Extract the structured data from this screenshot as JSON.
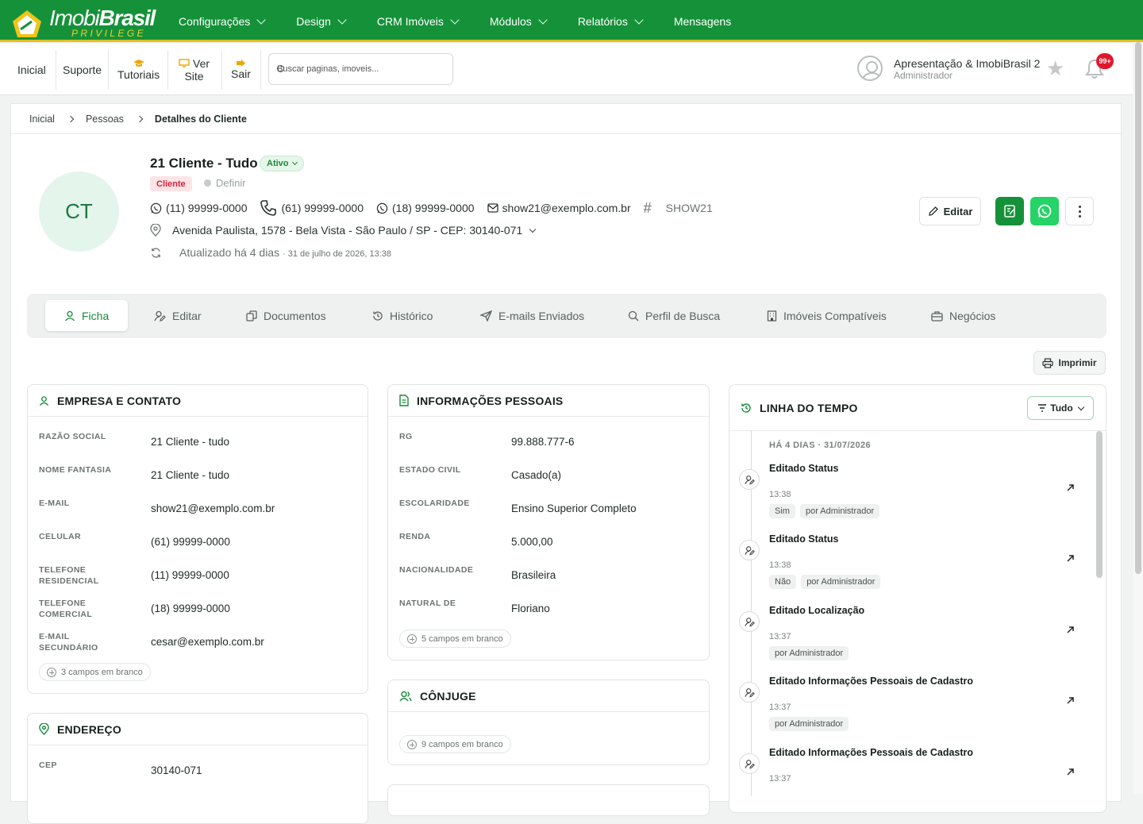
{
  "brand": {
    "name_light": "Imobi",
    "name_bold": "Brasil",
    "tagline": "PRIVILEGE"
  },
  "nav": [
    {
      "label": "Configurações",
      "has_dropdown": true
    },
    {
      "label": "Design",
      "has_dropdown": true
    },
    {
      "label": "CRM Imóveis",
      "has_dropdown": true
    },
    {
      "label": "Módulos",
      "has_dropdown": true
    },
    {
      "label": "Relatórios",
      "has_dropdown": true
    },
    {
      "label": "Mensagens",
      "has_dropdown": false
    }
  ],
  "quick_links": {
    "inicial": "Inicial",
    "suporte": "Suporte",
    "tutoriais": "Tutoriais",
    "ver": "Ver",
    "site": "Site",
    "sair": "Sair"
  },
  "search": {
    "placeholder": "Buscar paginas, imoveis..."
  },
  "user": {
    "name": "Apresentação & ImobiBrasil 2",
    "role": "Administrador",
    "notifications": "99+"
  },
  "breadcrumb": [
    "Inicial",
    "Pessoas",
    "Detalhes do Cliente"
  ],
  "client": {
    "initials": "CT",
    "name": "21 Cliente - Tudo",
    "status": "Ativo",
    "type_tag": "Cliente",
    "define_label": "Definir",
    "phone_whatsapp_1": "(11) 99999-0000",
    "phone_mobile": "(61) 99999-0000",
    "phone_whatsapp_2": "(18) 99999-0000",
    "email": "show21@exemplo.com.br",
    "code": "SHOW21",
    "address": "Avenida Paulista, 1578 - Bela Vista - São Paulo / SP - CEP: 30140-071",
    "updated": "Atualizado há 4 dias",
    "updated_date": "· 31 de julho de 2026, 13:38"
  },
  "actions": {
    "edit": "Editar",
    "print": "Imprimir"
  },
  "colors": {
    "brand_green": "#159239",
    "accent_yellow": "#e3c01f",
    "whatsapp": "#25d366",
    "badge_red": "#e0182d"
  },
  "tabs": [
    {
      "label": "Ficha",
      "icon": "user-icon",
      "active": true
    },
    {
      "label": "Editar",
      "icon": "user-edit-icon"
    },
    {
      "label": "Documentos",
      "icon": "documents-icon"
    },
    {
      "label": "Histórico",
      "icon": "history-icon"
    },
    {
      "label": "E-mails Enviados",
      "icon": "send-icon"
    },
    {
      "label": "Perfil de Busca",
      "icon": "search-icon"
    },
    {
      "label": "Imóveis Compatíveis",
      "icon": "building-icon"
    },
    {
      "label": "Negócios",
      "icon": "briefcase-icon"
    }
  ],
  "empresa": {
    "title": "EMPRESA E CONTATO",
    "rows": [
      {
        "label": "RAZÃO SOCIAL",
        "value": "21 Cliente - tudo"
      },
      {
        "label": "NOME FANTASIA",
        "value": "21 Cliente - tudo"
      },
      {
        "label": "E-MAIL",
        "value": "show21@exemplo.com.br"
      },
      {
        "label": "CELULAR",
        "value": "(61) 99999-0000"
      },
      {
        "label": "TELEFONE RESIDENCIAL",
        "value": "(11) 99999-0000"
      },
      {
        "label": "TELEFONE COMERCIAL",
        "value": "(18) 99999-0000"
      },
      {
        "label": "E-MAIL SECUNDÁRIO",
        "value": "cesar@exemplo.com.br"
      }
    ],
    "blank": "3 campos em branco"
  },
  "endereco": {
    "title": "ENDEREÇO",
    "rows": [
      {
        "label": "CEP",
        "value": "30140-071"
      }
    ]
  },
  "pessoais": {
    "title": "INFORMAÇÕES PESSOAIS",
    "rows": [
      {
        "label": "RG",
        "value": "99.888.777-6"
      },
      {
        "label": "ESTADO CIVIL",
        "value": "Casado(a)"
      },
      {
        "label": "ESCOLARIDADE",
        "value": "Ensino Superior Completo"
      },
      {
        "label": "RENDA",
        "value": "5.000,00"
      },
      {
        "label": "NACIONALIDADE",
        "value": "Brasileira"
      },
      {
        "label": "NATURAL DE",
        "value": "Floriano"
      }
    ],
    "blank": "5 campos em branco"
  },
  "conjuge": {
    "title": "CÔNJUGE",
    "blank": "9 campos em branco"
  },
  "timeline": {
    "title": "LINHA DO TEMPO",
    "filter": "Tudo",
    "day": "HÁ 4 DIAS · 31/07/2026",
    "events": [
      {
        "title": "Editado Status",
        "time": "13:38",
        "chips": [
          "Sim",
          "por Administrador"
        ]
      },
      {
        "title": "Editado Status",
        "time": "13:38",
        "chips": [
          "Não",
          "por Administrador"
        ]
      },
      {
        "title": "Editado Localização",
        "time": "13:37",
        "chips": [
          "por Administrador"
        ]
      },
      {
        "title": "Editado Informações Pessoais de Cadastro",
        "time": "13:37",
        "chips": [
          "por Administrador"
        ]
      },
      {
        "title": "Editado Informações Pessoais de Cadastro",
        "time": "13:37",
        "chips": []
      }
    ]
  }
}
